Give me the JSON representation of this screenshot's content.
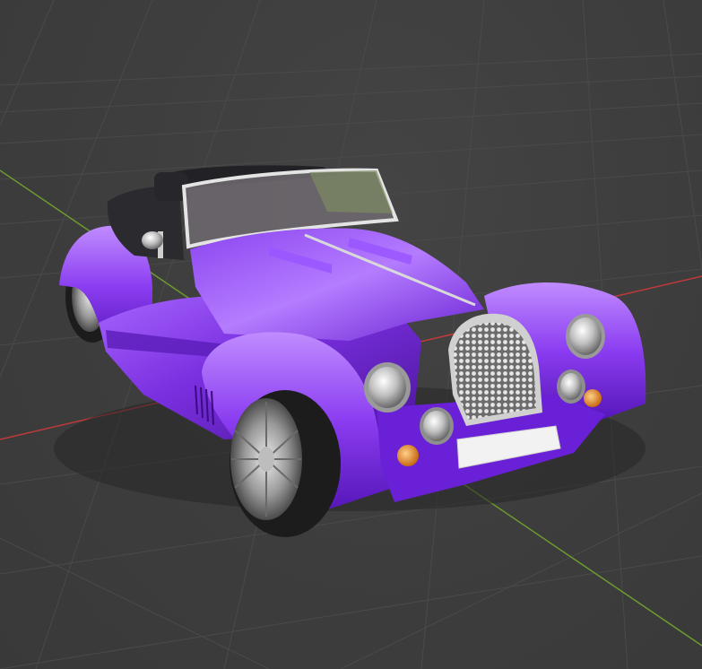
{
  "viewport": {
    "background_color": "#3d3d3d",
    "grid_color": "#4a4a4a",
    "x_axis_color": "#c0393b",
    "y_axis_color": "#6b9b2f"
  },
  "scene": {
    "object": "convertible-roadster",
    "body_color": "#7a2fe0",
    "body_highlight": "#c58cff",
    "body_shadow": "#3e0f86",
    "chrome_color": "#d8d8d8",
    "tire_color": "#1c1c1c",
    "seat_color": "#2b2b2f",
    "indicator_color": "#e08a1e"
  }
}
